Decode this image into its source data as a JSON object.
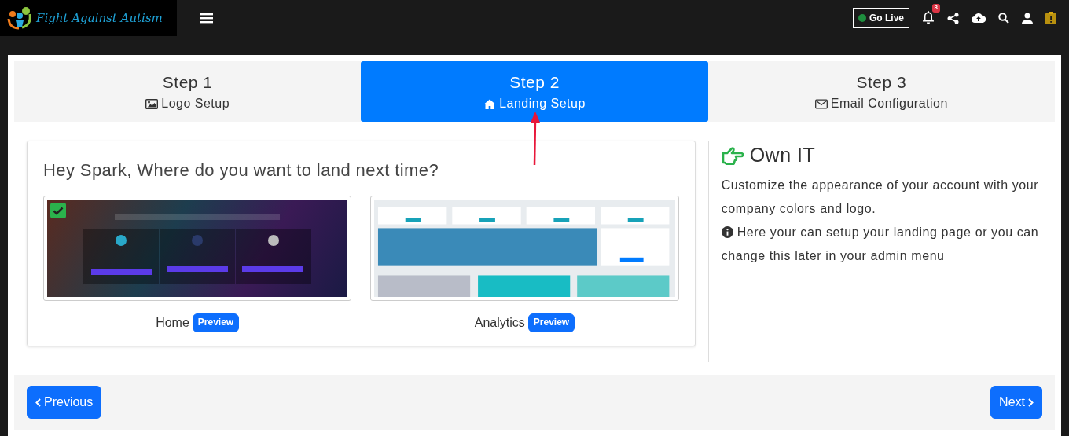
{
  "brand": {
    "name": "Fight Against Autism"
  },
  "topbar": {
    "go_live": "Go Live",
    "notification_count": "3"
  },
  "steps": [
    {
      "title": "Step 1",
      "label": "Logo Setup",
      "selected": false
    },
    {
      "title": "Step 2",
      "label": "Landing Setup",
      "selected": true
    },
    {
      "title": "Step 3",
      "label": "Email Configuration",
      "selected": false
    }
  ],
  "landing": {
    "heading": "Hey Spark, Where do you want to land next time?",
    "options": [
      {
        "name": "Home",
        "preview": "Preview",
        "kind": "services",
        "selected": true
      },
      {
        "name": "Analytics",
        "preview": "Preview",
        "kind": "dashboard",
        "selected": false
      }
    ]
  },
  "info": {
    "title": "Own IT",
    "lines": [
      {
        "kind": "plain",
        "text": "Customize the appearance of your account with your company colors and logo."
      },
      {
        "kind": "info",
        "text": "Here your can setup your landing page or you can change this later in your admin menu"
      }
    ]
  },
  "nav": {
    "previous": "Previous",
    "next": "Next"
  }
}
